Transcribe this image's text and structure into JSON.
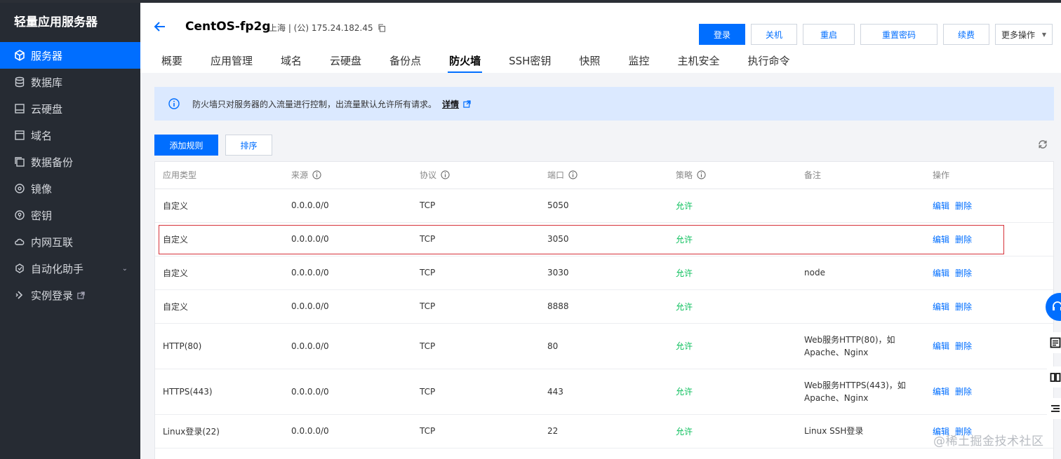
{
  "sidebar": {
    "title": "轻量应用服务器",
    "items": [
      {
        "label": "服务器",
        "icon": "server-icon",
        "active": true
      },
      {
        "label": "数据库",
        "icon": "database-icon"
      },
      {
        "label": "云硬盘",
        "icon": "disk-icon"
      },
      {
        "label": "域名",
        "icon": "domain-icon"
      },
      {
        "label": "数据备份",
        "icon": "backup-icon"
      },
      {
        "label": "镜像",
        "icon": "image-icon"
      },
      {
        "label": "密钥",
        "icon": "key-icon"
      },
      {
        "label": "内网互联",
        "icon": "network-icon"
      },
      {
        "label": "自动化助手",
        "icon": "automation-icon"
      },
      {
        "label": "实例登录",
        "icon": "login-icon"
      }
    ]
  },
  "header": {
    "server_name": "CentOS-fp2g",
    "server_meta": "上海 | (公) 175.24.182.45",
    "buttons": {
      "login": "登录",
      "shutdown": "关机",
      "restart": "重启",
      "reset_password": "重置密码",
      "renew": "续费",
      "more": "更多操作"
    },
    "tabs": [
      "概要",
      "应用管理",
      "域名",
      "云硬盘",
      "备份点",
      "防火墙",
      "SSH密钥",
      "快照",
      "监控",
      "主机安全",
      "执行命令"
    ],
    "active_tab": "防火墙"
  },
  "notice": {
    "text": "防火墙只对服务器的入流量进行控制，出流量默认允许所有请求。",
    "link": "详情"
  },
  "toolbar": {
    "add_rule": "添加规则",
    "sort": "排序"
  },
  "table": {
    "headers": {
      "app_type": "应用类型",
      "source": "来源",
      "protocol": "协议",
      "port": "端口",
      "policy": "策略",
      "remark": "备注",
      "ops": "操作"
    },
    "edit_label": "编辑",
    "delete_label": "删除",
    "rows": [
      {
        "app_type": "自定义",
        "source": "0.0.0.0/0",
        "protocol": "TCP",
        "port": "5050",
        "policy": "允许",
        "remark": [
          "",
          ""
        ]
      },
      {
        "app_type": "自定义",
        "source": "0.0.0.0/0",
        "protocol": "TCP",
        "port": "3050",
        "policy": "允许",
        "remark": [
          "",
          ""
        ]
      },
      {
        "app_type": "自定义",
        "source": "0.0.0.0/0",
        "protocol": "TCP",
        "port": "3030",
        "policy": "允许",
        "remark": [
          "node",
          ""
        ]
      },
      {
        "app_type": "自定义",
        "source": "0.0.0.0/0",
        "protocol": "TCP",
        "port": "8888",
        "policy": "允许",
        "remark": [
          "",
          ""
        ]
      },
      {
        "app_type": "HTTP(80)",
        "source": "0.0.0.0/0",
        "protocol": "TCP",
        "port": "80",
        "policy": "允许",
        "remark": [
          "Web服务HTTP(80)，如",
          "Apache、Nginx"
        ]
      },
      {
        "app_type": "HTTPS(443)",
        "source": "0.0.0.0/0",
        "protocol": "TCP",
        "port": "443",
        "policy": "允许",
        "remark": [
          "Web服务HTTPS(443)，如",
          "Apache、Nginx"
        ]
      },
      {
        "app_type": "Linux登录(22)",
        "source": "0.0.0.0/0",
        "protocol": "TCP",
        "port": "22",
        "policy": "允许",
        "remark": [
          "Linux SSH登录",
          ""
        ]
      }
    ]
  },
  "watermark": "@稀土掘金技术社区",
  "colors": {
    "accent": "#006eff",
    "allow": "#0abf5b",
    "sidebar_bg": "#262b33",
    "highlight": "#d6323a",
    "notice_bg": "#dbe9ff"
  }
}
